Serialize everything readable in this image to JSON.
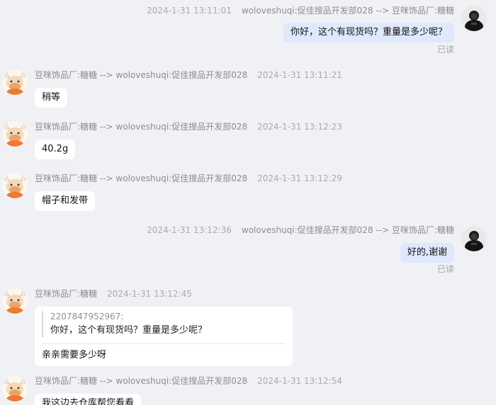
{
  "buyer": {
    "name": "woloveshuqi:促佳搜品开发部028",
    "avatar_icon": "buyer-avatar-icon"
  },
  "seller": {
    "name": "豆咪饰品厂:糖糖",
    "avatar_icon": "cow-mascot-avatar-icon"
  },
  "arrow": "-->",
  "read_label": "已读",
  "messages": [
    {
      "side": "right",
      "from": "woloveshuqi:促佳搜品开发部028",
      "to": "豆咪饰品厂:糖糖",
      "time": "2024-1-31 13:11:01",
      "text": "你好，这个有现货吗？重量是多少呢？",
      "read": "已读"
    },
    {
      "side": "left",
      "from": "豆咪饰品厂:糖糖",
      "to": "woloveshuqi:促佳搜品开发部028",
      "time": "2024-1-31 13:11:21",
      "text": "稍等"
    },
    {
      "side": "left",
      "from": "豆咪饰品厂:糖糖",
      "to": "woloveshuqi:促佳搜品开发部028",
      "time": "2024-1-31 13:12:23",
      "text": "40.2g"
    },
    {
      "side": "left",
      "from": "豆咪饰品厂:糖糖",
      "to": "woloveshuqi:促佳搜品开发部028",
      "time": "2024-1-31 13:12:29",
      "text": "帽子和发带"
    },
    {
      "side": "right",
      "from": "woloveshuqi:促佳搜品开发部028",
      "to": "豆咪饰品厂:糖糖",
      "time": "2024-1-31 13:12:36",
      "text": "好的,谢谢",
      "read": "已读"
    },
    {
      "side": "left",
      "from": "豆咪饰品厂:糖糖",
      "time": "2024-1-31 13:12:45",
      "quote_author": "2207847952967:",
      "quote_text": "你好，这个有现货吗？重量是多少呢？",
      "text": "亲亲需要多少呀"
    },
    {
      "side": "left",
      "from": "豆咪饰品厂:糖糖",
      "to": "woloveshuqi:促佳搜品开发部028",
      "time": "2024-1-31 13:12:54",
      "text": "我这边去仓库帮您看看"
    }
  ]
}
